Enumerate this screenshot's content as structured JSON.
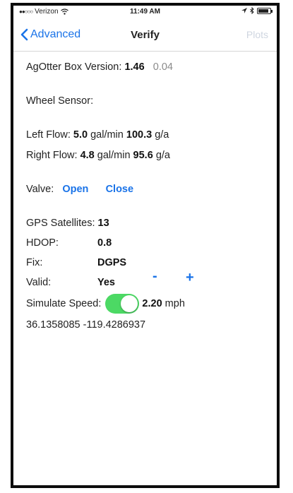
{
  "status": {
    "carrier": "Verizon",
    "time": "11:49 AM"
  },
  "nav": {
    "back_label": "Advanced",
    "title": "Verify",
    "right_label": "Plots"
  },
  "version": {
    "label": "AgOtter Box Version:",
    "value": "1.46",
    "secondary": "0.04"
  },
  "wheel_sensor": {
    "label": "Wheel Sensor:"
  },
  "left_flow": {
    "label": "Left Flow:",
    "rate": "5.0",
    "rate_unit": "gal/min",
    "area": "100.3",
    "area_unit": "g/a"
  },
  "right_flow": {
    "label": "Right Flow:",
    "rate": "4.8",
    "rate_unit": "gal/min",
    "area": "95.6",
    "area_unit": "g/a"
  },
  "valve": {
    "label": "Valve:",
    "open_label": "Open",
    "close_label": "Close"
  },
  "gps": {
    "satellites_label": "GPS Satellites:",
    "satellites": "13",
    "hdop_label": "HDOP:",
    "hdop": "0.8",
    "fix_label": "Fix:",
    "fix": "DGPS",
    "valid_label": "Valid:",
    "valid": "Yes"
  },
  "stepper": {
    "minus": "-",
    "plus": "+"
  },
  "simulate": {
    "label": "Simulate Speed:",
    "enabled": true,
    "speed": "2.20",
    "unit": "mph"
  },
  "coords": {
    "lat": "36.1358085",
    "lon": "-119.4286937"
  },
  "colors": {
    "accent": "#1a73e8",
    "toggle_on": "#4cd964"
  }
}
